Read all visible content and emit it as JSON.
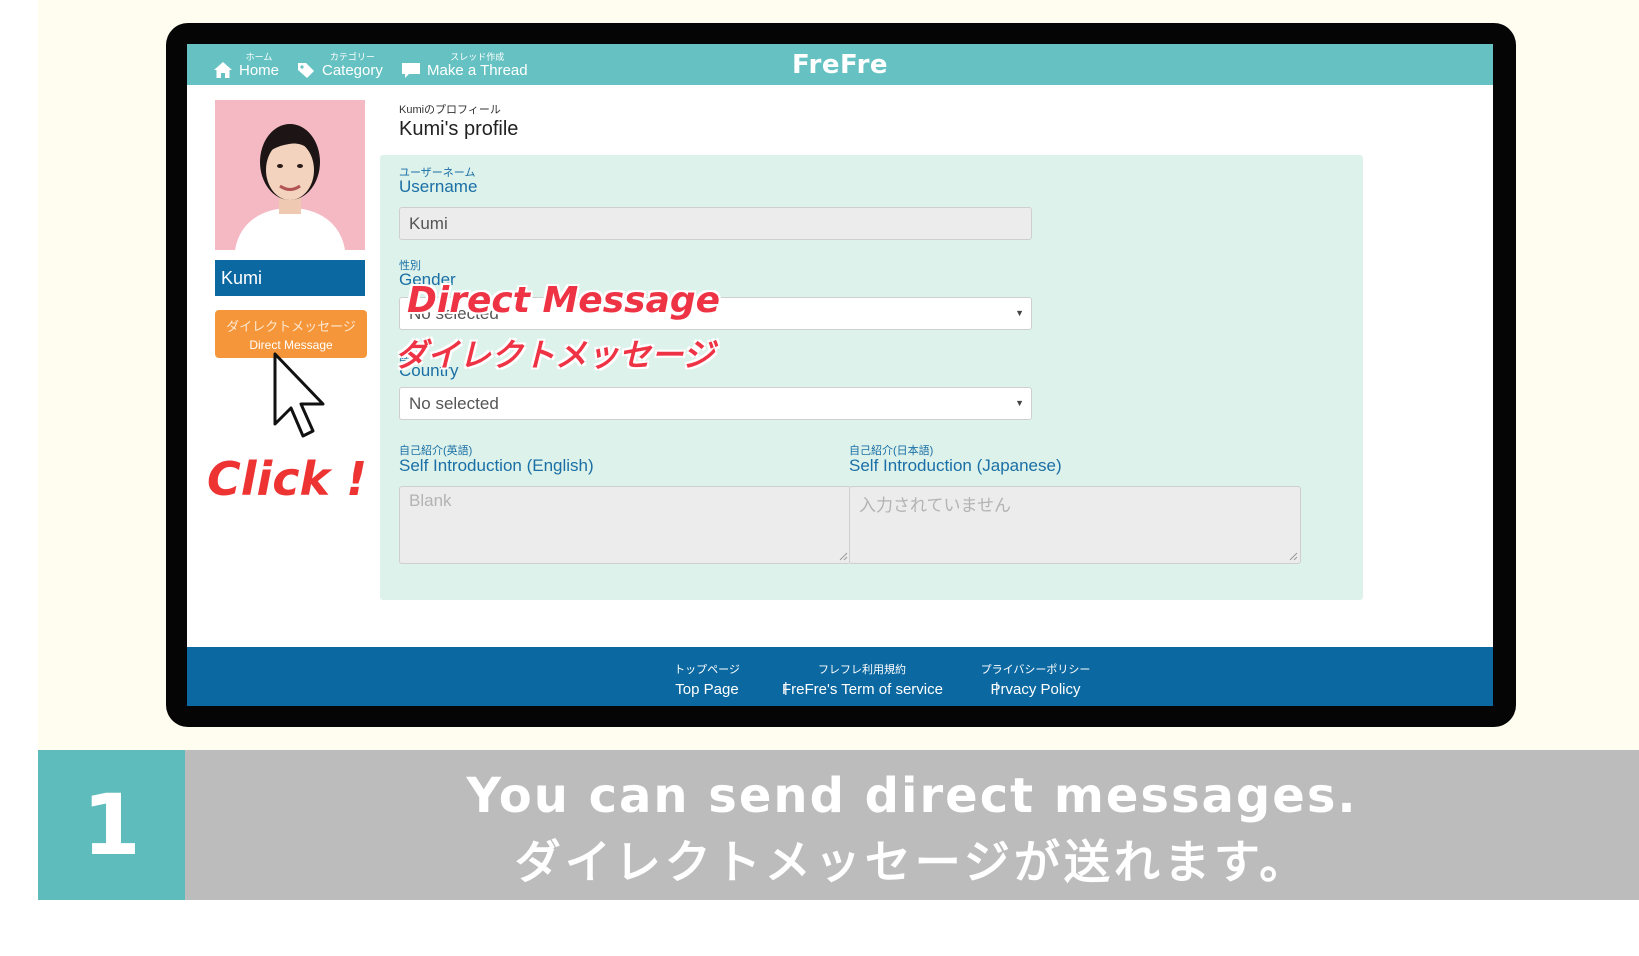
{
  "header": {
    "logo": "FreFre",
    "nav": [
      {
        "small": "ホーム",
        "label": "Home"
      },
      {
        "small": "カテゴリー",
        "label": "Category"
      },
      {
        "small": "スレッド作成",
        "label": "Make a Thread"
      }
    ]
  },
  "sidebar": {
    "username": "Kumi",
    "dm_button_jp": "ダイレクトメッセージ",
    "dm_button_en": "Direct Message",
    "click_annotation": "Click !"
  },
  "profile": {
    "title_small": "Kumiのプロフィール",
    "title": "Kumi's profile",
    "username_label_small": "ユーザーネーム",
    "username_label": "Username",
    "username_value": "Kumi",
    "gender_label_small": "性別",
    "gender_label": "Gender",
    "gender_value": "No selected",
    "country_label_small": "国籍",
    "country_label": "Country",
    "country_value": "No selected",
    "intro_en_label_small": "自己紹介(英語)",
    "intro_en_label": "Self Introduction (English)",
    "intro_en_placeholder": "Blank",
    "intro_jp_label_small": "自己紹介(日本語)",
    "intro_jp_label": "Self Introduction (Japanese)",
    "intro_jp_placeholder": "入力されていません"
  },
  "overlay": {
    "en": "Direct Message",
    "jp": "ダイレクトメッセージ"
  },
  "footer": {
    "links": [
      {
        "small": "トップページ",
        "label": "Top Page"
      },
      {
        "small": "フレフレ利用規約",
        "label": "FreFre's Term of service"
      },
      {
        "small": "プライバシーポリシー",
        "label": "Prvacy Policy"
      }
    ],
    "separator": "|"
  },
  "caption": {
    "step_number": "1",
    "en": "You can send direct messages.",
    "jp": "ダイレクトメッセージが送れます。"
  },
  "colors": {
    "header": "#66c2c2",
    "brand_blue": "#0b68a0",
    "dm_orange": "#f5963a",
    "annotation_red": "#ee3344",
    "panel_green": "#ddf2ea",
    "caption_gray": "#bcbcbc",
    "step_teal": "#5fbcbc"
  }
}
